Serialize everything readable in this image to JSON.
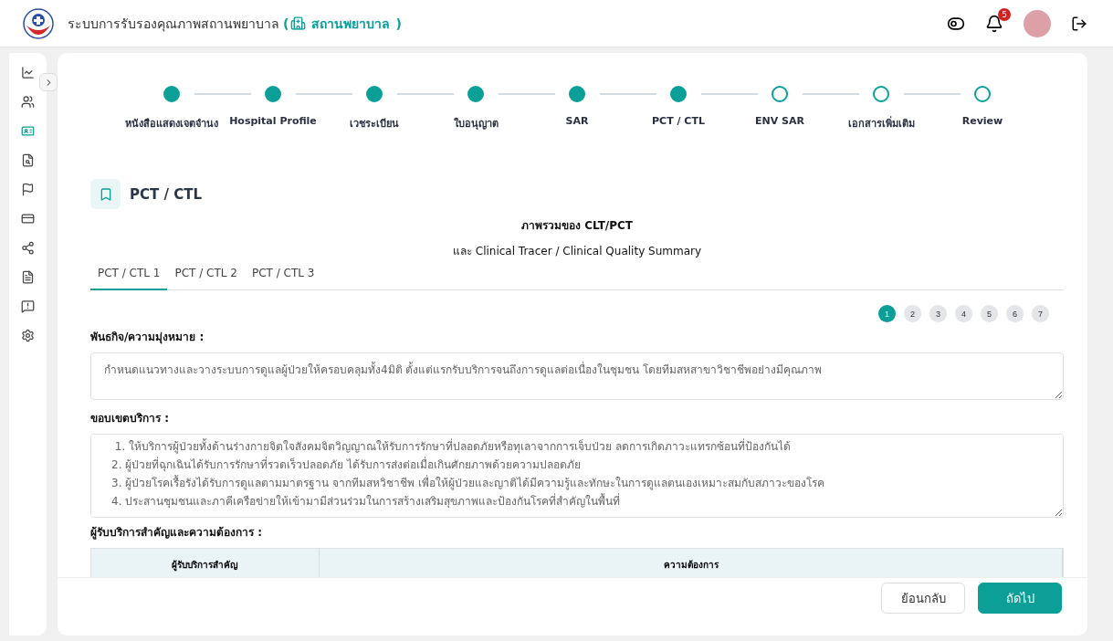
{
  "header": {
    "title": "ระบบการรับรองคุณภาพสถานพยาบาล",
    "role_open": "(",
    "role": "สถานพยาบาล",
    "role_close": ")",
    "notification_count": "5"
  },
  "sidebar": {
    "items": [
      {
        "selected": false
      },
      {
        "selected": false
      },
      {
        "selected": true
      },
      {
        "selected": false
      },
      {
        "selected": false
      },
      {
        "selected": false
      },
      {
        "selected": false
      },
      {
        "selected": false
      },
      {
        "selected": false
      },
      {
        "selected": false
      }
    ]
  },
  "stepper": [
    {
      "label": "หนังสือแสดงเจตจำนง",
      "done": true
    },
    {
      "label": "Hospital Profile",
      "done": true
    },
    {
      "label": "เวชระเบียน",
      "done": true
    },
    {
      "label": "ใบอนุญาต",
      "done": true
    },
    {
      "label": "SAR",
      "done": true
    },
    {
      "label": "PCT / CTL",
      "done": true
    },
    {
      "label": "ENV SAR",
      "done": false
    },
    {
      "label": "เอกสารเพิ่มเติม",
      "done": false
    },
    {
      "label": "Review",
      "done": false
    }
  ],
  "section": {
    "title": "PCT / CTL",
    "heading": "ภาพรวมของ CLT/PCT",
    "subheading": "และ Clinical Tracer / Clinical Quality Summary"
  },
  "tabs": [
    {
      "label": "PCT / CTL 1",
      "selected": true
    },
    {
      "label": "PCT / CTL 2",
      "selected": false
    },
    {
      "label": "PCT / CTL 3",
      "selected": false
    }
  ],
  "pages": [
    {
      "label": "1",
      "selected": true
    },
    {
      "label": "2",
      "selected": false
    },
    {
      "label": "3",
      "selected": false
    },
    {
      "label": "4",
      "selected": false
    },
    {
      "label": "5",
      "selected": false
    },
    {
      "label": "6",
      "selected": false
    },
    {
      "label": "7",
      "selected": false
    }
  ],
  "mission": {
    "label": "พันธกิจ/ความมุ่งหมาย :",
    "value": "กำหนดแนวทางและวางระบบการดูแลผู้ป่วยให้ครอบคลุมทั้ง4มิติ ตั้งแต่แรกรับบริการจนถึงการดูแลต่อเนื่องในชุมชน โดยทีมสหสาขาวิชาชีพอย่างมีคุณภาพ"
  },
  "scope": {
    "label": "ขอบเขตบริการ :",
    "lines": [
      " 1. ให้บริการผู้ป่วยทั้งด้านร่างกายจิตใจสังคมจิตวิญญาณให้รับการรักษาที่ปลอดภัยหรือทุเลาจากการเจ็บป่วย ลดการเกิดภาวะแทรกซ้อนที่ป้องกันได้",
      "2. ผู้ป่วยที่ฉุกเฉินได้รับการรักษาที่รวดเร็วปลอดภัย ได้รับการส่งต่อเมื่อเกินศักยภาพด้วยความปลอดภัย",
      "3. ผู้ป่วยโรคเรื้อรังได้รับการดูแลตามมาตรฐาน จากทีมสหวิชาชีพ เพื่อให้ผู้ป่วยและญาติได้มีความรู้และทักษะในการดูแลตนเองเหมาะสมกับสภาวะของโรค",
      "4. ประสานชุมชนและภาคีเครือข่ายให้เข้ามามีส่วนร่วมในการสร้างเสริมสุขภาพและป้องกันโรคที่สำคัญในพื้นที่"
    ]
  },
  "customers": {
    "label": "ผู้รับบริการสำคัญและความต้องการ :",
    "columns": [
      "ผู้รับบริการสำคัญ",
      "ความต้องการ"
    ]
  },
  "footer": {
    "back": "ย้อนกลับ",
    "next": "ถัดไป"
  }
}
